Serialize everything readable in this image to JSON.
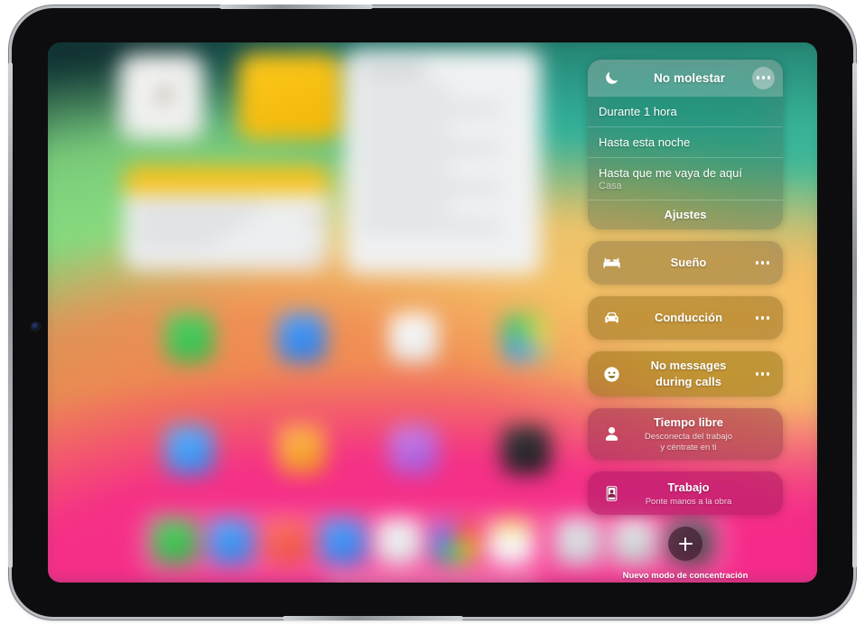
{
  "device": {
    "kind": "tablet-frame",
    "camera": "front-camera-dot"
  },
  "wallpaper": {
    "description": "blurred home screen with multicolour gradient wallpaper",
    "colors": [
      "#143c3d",
      "#33b9a2",
      "#88d97d",
      "#f6c267",
      "#f0834f",
      "#f52a8a"
    ]
  },
  "focus_panel": {
    "do_not_disturb": {
      "icon": "moon-icon",
      "title": "No molestar",
      "more_label": "…",
      "options": [
        {
          "label": "Durante 1 hora",
          "sub": ""
        },
        {
          "label": "Hasta esta noche",
          "sub": ""
        },
        {
          "label": "Hasta que me vaya de aquí",
          "sub": "Casa"
        }
      ],
      "settings_label": "Ajustes"
    },
    "modes": [
      {
        "icon": "bed-icon",
        "name": "Sueño",
        "desc": "",
        "tint": "c-sleep"
      },
      {
        "icon": "car-icon",
        "name": "Conducción",
        "desc": "",
        "tint": "c-drive"
      },
      {
        "icon": "smiley-icon",
        "name": "No messages\nduring calls",
        "desc": "",
        "tint": "c-calls"
      },
      {
        "icon": "person-icon",
        "name": "Tiempo libre",
        "desc": "Desconecta del trabajo\ny céntrate en ti",
        "tint": "c-free"
      },
      {
        "icon": "id-badge-icon",
        "name": "Trabajo",
        "desc": "Ponte manos a la obra",
        "tint": "c-work"
      }
    ],
    "new_focus": {
      "button_label": "+",
      "caption": "Nuevo modo de concentración"
    }
  },
  "home_screen": {
    "widgets": [
      {
        "name": "clock-widget"
      },
      {
        "name": "yellow-widget"
      },
      {
        "name": "notes-widget"
      },
      {
        "name": "mail-widget"
      }
    ],
    "app_rows": [
      [
        "#4cc95a",
        "#3b8ef0",
        "#f2f3f4",
        "#3e9e5c"
      ],
      [
        "#4a9ff0",
        "#f5a02a",
        "#b268e0",
        "#2b2b2d"
      ]
    ],
    "dock_icons": [
      "#4cc95a",
      "#3b8ef0",
      "#ee5a52",
      "#3f8ef2",
      "#eceef0",
      "#e8e4df",
      "#f7d255",
      "#d9dade",
      "#cfd2d6",
      "#8f9398",
      "#c9cbd0"
    ]
  }
}
